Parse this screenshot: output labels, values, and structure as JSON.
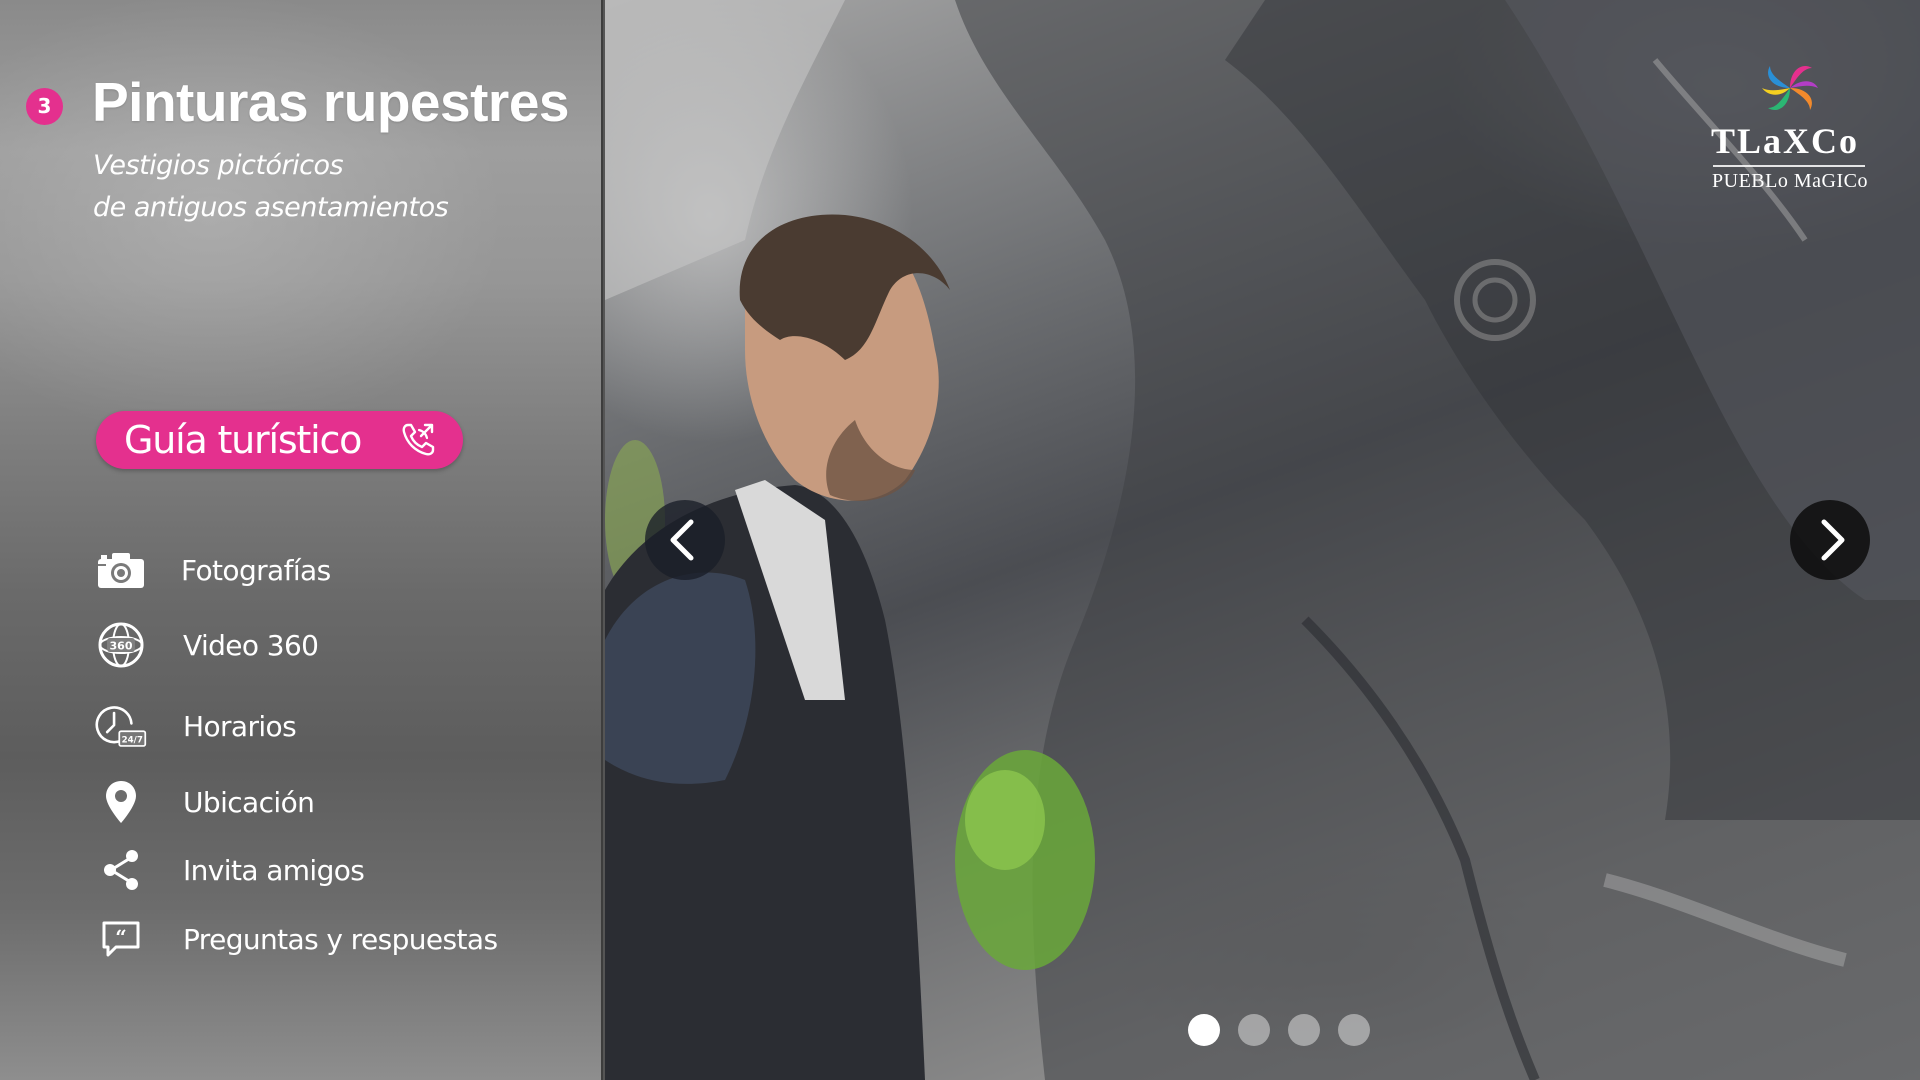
{
  "attraction": {
    "number": "3",
    "title": "Pinturas rupestres",
    "subtitle_line1": "Vestigios pictóricos",
    "subtitle_line2": "de antiguos asentamientos"
  },
  "guide_button": {
    "label": "Guía turístico",
    "icon": "phone-call-icon"
  },
  "menu": [
    {
      "label": "Fotografías",
      "icon": "camera-icon"
    },
    {
      "label": "Video 360",
      "icon": "video-360-icon",
      "icon_text": "360"
    },
    {
      "label": "Horarios",
      "icon": "clock-24-7-icon",
      "icon_text": "24/7"
    },
    {
      "label": "Ubicación",
      "icon": "location-pin-icon"
    },
    {
      "label": "Invita amigos",
      "icon": "share-icon"
    },
    {
      "label": "Preguntas y respuestas",
      "icon": "chat-quote-icon"
    }
  ],
  "gallery": {
    "total_slides": 4,
    "active_slide": 1,
    "prev_icon": "chevron-left-icon",
    "next_icon": "chevron-right-icon"
  },
  "logo": {
    "name": "TLaXCo",
    "tagline": "PUEBLo MaGICo"
  },
  "colors": {
    "accent": "#e4308e",
    "panel": "#7a7a7a",
    "text": "#ffffff"
  }
}
